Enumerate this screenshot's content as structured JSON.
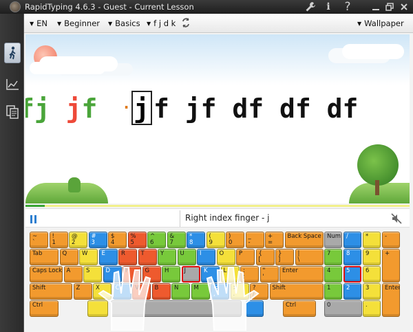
{
  "window": {
    "title": "RapidTyping 4.6.3 - Guest - Current Lesson"
  },
  "toolbar": {
    "language": "EN",
    "level": "Beginner",
    "course": "Basics",
    "lesson_keys": "f j d k",
    "wallpaper": "Wallpaper"
  },
  "lesson": {
    "typed_before": "fj jf",
    "current_char": "j",
    "remaining": "f jf df df df"
  },
  "progress": {
    "fraction": 0.05
  },
  "status": {
    "finger_hint": "Right index finger - j"
  },
  "keyboard": {
    "row1": [
      "~\n`",
      "!\n1",
      "@\n2",
      "#\n3",
      "$\n4",
      "%\n5",
      "^\n6",
      "&\n7",
      "*\n8",
      "(\n9",
      ")\n0",
      "_\n-",
      "+\n=",
      "Back Space"
    ],
    "row2": [
      "Tab",
      "Q",
      "W",
      "E",
      "R",
      "T",
      "Y",
      "U",
      "I",
      "O",
      "P",
      "{\n[",
      "}\n]",
      "|\n\\"
    ],
    "row3": [
      "Caps Lock",
      "A",
      "S",
      "D",
      "F",
      "G",
      "H",
      "J",
      "K",
      "L",
      ":\n;",
      "\"\n'",
      "Enter"
    ],
    "row4": [
      "Shift",
      "Z",
      "X",
      "C",
      "V",
      "B",
      "N",
      "M",
      "<\n,",
      ">\n.",
      "?\n/",
      "Shift"
    ],
    "row5": [
      "Ctrl",
      "",
      "",
      "Ctrl"
    ],
    "numpad": [
      "Num Lock",
      "/",
      "*",
      "-",
      "7",
      "8",
      "9",
      "+",
      "4",
      "5",
      "6",
      "1",
      "2",
      "3",
      "Enter",
      "0",
      "."
    ]
  },
  "colors": {
    "orange": "#f29a2e",
    "yellow": "#f4e03a",
    "green": "#78c93b",
    "blue": "#2d8fe6",
    "red": "#ee5a2e",
    "progress": "#3aa535"
  }
}
